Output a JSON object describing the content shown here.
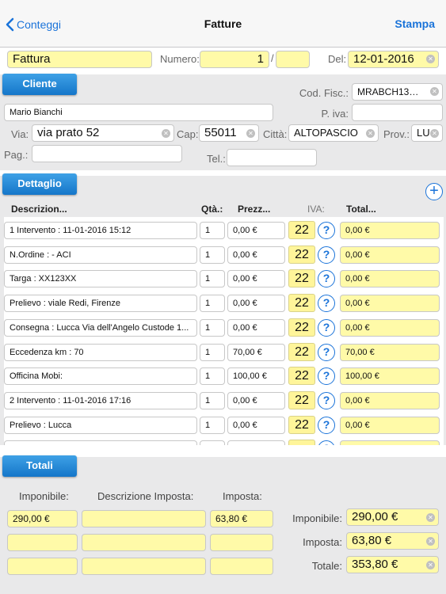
{
  "nav": {
    "back_label": "Conteggi",
    "title": "Fatture",
    "action_label": "Stampa"
  },
  "header": {
    "doc_type": "Fattura",
    "numero_label": "Numero:",
    "numero_value": "1",
    "separator": "/",
    "numero_suffix": "",
    "del_label": "Del:",
    "date_value": "12-01-2016"
  },
  "cliente": {
    "tab_label": "Cliente",
    "cod_fisc_label": "Cod. Fisc.:",
    "cod_fisc_value": "MRABCH13…",
    "name_value": "Mario Bianchi",
    "piva_label": "P. iva:",
    "piva_value": "",
    "via_label": "Via:",
    "via_value": "via prato 52",
    "cap_label": "Cap:",
    "cap_value": "55011",
    "citta_label": "Città:",
    "citta_value": "ALTOPASCIO",
    "prov_label": "Prov.:",
    "prov_value": "LU",
    "pag_label": "Pag.:",
    "pag_value": "",
    "tel_label": "Tel.:",
    "tel_value": ""
  },
  "dettaglio": {
    "tab_label": "Dettaglio",
    "columns": {
      "descrizione": "Descrizion...",
      "qta": "Qtà.:",
      "prezzo": "Prezz...",
      "iva": "IVA:",
      "totale": "Total..."
    },
    "question_glyph": "?",
    "add_glyph": "+",
    "rows": [
      {
        "descr": "1 Intervento : 11-01-2016 15:12",
        "qty": "1",
        "price": "0,00 €",
        "vat": "22",
        "total": "0,00 €"
      },
      {
        "descr": "N.Ordine    :  - ACI",
        "qty": "1",
        "price": "0,00 €",
        "vat": "22",
        "total": "0,00 €"
      },
      {
        "descr": "Targa        : XX123XX",
        "qty": "1",
        "price": "0,00 €",
        "vat": "22",
        "total": "0,00 €"
      },
      {
        "descr": "Prelievo    : viale Redi, Firenze",
        "qty": "1",
        "price": "0,00 €",
        "vat": "22",
        "total": "0,00 €"
      },
      {
        "descr": "Consegna    : Lucca Via dell'Angelo Custode 1...",
        "qty": "1",
        "price": "0,00 €",
        "vat": "22",
        "total": "0,00 €"
      },
      {
        "descr": "Eccedenza km : 70",
        "qty": "1",
        "price": "70,00 €",
        "vat": "22",
        "total": "70,00 €"
      },
      {
        "descr": "Officina Mobi:",
        "qty": "1",
        "price": "100,00 €",
        "vat": "22",
        "total": "100,00 €"
      },
      {
        "descr": "2 Intervento : 11-01-2016 17:16",
        "qty": "1",
        "price": "0,00 €",
        "vat": "22",
        "total": "0,00 €"
      },
      {
        "descr": "Prelievo     : Lucca",
        "qty": "1",
        "price": "0,00 €",
        "vat": "22",
        "total": "0,00 €"
      }
    ]
  },
  "totali": {
    "tab_label": "Totali",
    "col_imponibile": "Imponibile:",
    "col_descr": "Descrizione Imposta:",
    "col_imposta": "Imposta:",
    "rows": [
      {
        "imponibile": "290,00 €",
        "descr": "",
        "imposta": "63,80 €"
      },
      {
        "imponibile": "",
        "descr": "",
        "imposta": ""
      },
      {
        "imponibile": "",
        "descr": "",
        "imposta": ""
      }
    ],
    "imponibile_label": "Imponibile:",
    "imponibile_value": "290,00 €",
    "imposta_label": "Imposta:",
    "imposta_value": "63,80 €",
    "totale_label": "Totale:",
    "totale_value": "353,80 €"
  },
  "colors": {
    "accent": "#1a73d9",
    "field_yellow": "#fffaa8",
    "tab_blue": "#1576c9"
  }
}
